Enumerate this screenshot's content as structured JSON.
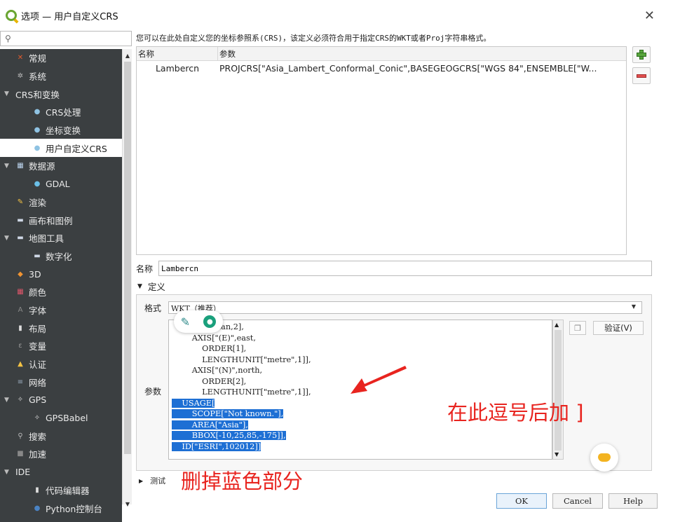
{
  "window": {
    "title": "选项 — 用户自定义CRS",
    "close_label": "✕"
  },
  "search": {
    "placeholder": ""
  },
  "sidebar": {
    "items": [
      {
        "label": "常规",
        "icon": "wrench-icon",
        "level": 0
      },
      {
        "label": "系统",
        "icon": "gear-icon",
        "level": 0
      },
      {
        "label": "CRS和变换",
        "icon": "",
        "level": 0,
        "expanded": true
      },
      {
        "label": "CRS处理",
        "icon": "globe-icon",
        "level": 1
      },
      {
        "label": "坐标变换",
        "icon": "globe-icon",
        "level": 1
      },
      {
        "label": "用户自定义CRS",
        "icon": "globe-user-icon",
        "level": 1,
        "selected": true
      },
      {
        "label": "数据源",
        "icon": "table-icon",
        "level": 0,
        "expanded": true
      },
      {
        "label": "GDAL",
        "icon": "gdal-icon",
        "level": 1
      },
      {
        "label": "渲染",
        "icon": "brush-icon",
        "level": 0
      },
      {
        "label": "画布和图例",
        "icon": "canvas-icon",
        "level": 0
      },
      {
        "label": "地图工具",
        "icon": "map-tool-icon",
        "level": 0,
        "expanded": true
      },
      {
        "label": "数字化",
        "icon": "digitize-icon",
        "level": 1
      },
      {
        "label": "3D",
        "icon": "cube-icon",
        "level": 0
      },
      {
        "label": "颜色",
        "icon": "palette-icon",
        "level": 0
      },
      {
        "label": "字体",
        "icon": "font-icon",
        "level": 0
      },
      {
        "label": "布局",
        "icon": "layout-icon",
        "level": 0
      },
      {
        "label": "变量",
        "icon": "variable-icon",
        "level": 0
      },
      {
        "label": "认证",
        "icon": "lock-icon",
        "level": 0
      },
      {
        "label": "网络",
        "icon": "network-icon",
        "level": 0
      },
      {
        "label": "GPS",
        "icon": "gps-icon",
        "level": 0,
        "expanded": true
      },
      {
        "label": "GPSBabel",
        "icon": "gps-icon",
        "level": 1
      },
      {
        "label": "搜索",
        "icon": "search-icon",
        "level": 0
      },
      {
        "label": "加速",
        "icon": "acceleration-icon",
        "level": 0
      },
      {
        "label": "IDE",
        "icon": "",
        "level": 0,
        "expanded": true
      },
      {
        "label": "代码编辑器",
        "icon": "code-editor-icon",
        "level": 1
      },
      {
        "label": "Python控制台",
        "icon": "python-icon",
        "level": 1
      }
    ]
  },
  "main": {
    "info_text": "您可以在此处自定义您的坐标参照系(CRS)，该定义必须符合用于指定CRS的WKT或者Proj字符串格式。",
    "table": {
      "headers": [
        "名称",
        "参数"
      ],
      "rows": [
        {
          "name": "Lambercn",
          "params": "PROJCRS[\"Asia_Lambert_Conformal_Conic\",BASEGEOGCRS[\"WGS 84\",ENSEMBLE[\"W..."
        }
      ]
    },
    "name_label": "名称",
    "name_value": "Lambercn",
    "definition_label": "定义",
    "format_label": "格式",
    "format_value": "WKT（推荐）",
    "params_label": "参数",
    "editor_lines": [
      "        Cartesian,2],",
      "        AXIS[\"(E)\",east,",
      "            ORDER[1],",
      "            LENGTHUNIT[\"metre\",1]],",
      "        AXIS[\"(N)\",north,",
      "            ORDER[2],",
      "            LENGTHUNIT[\"metre\",1]],"
    ],
    "editor_highlighted_lines": [
      "    USAGE[",
      "        SCOPE[\"Not known.\"],",
      "        AREA[\"Asia\"],",
      "        BBOX[-10,25,85,-175]],",
      "    ID[\"ESRI\",102012]]"
    ],
    "validate_label": "验证(V)",
    "test_label": "测试"
  },
  "annotations": {
    "add_bracket": "在此逗号后加 ]",
    "delete_blue": "删掉蓝色部分",
    "color": "#e8241f"
  },
  "footer": {
    "ok": "OK",
    "cancel": "Cancel",
    "help": "Help"
  }
}
